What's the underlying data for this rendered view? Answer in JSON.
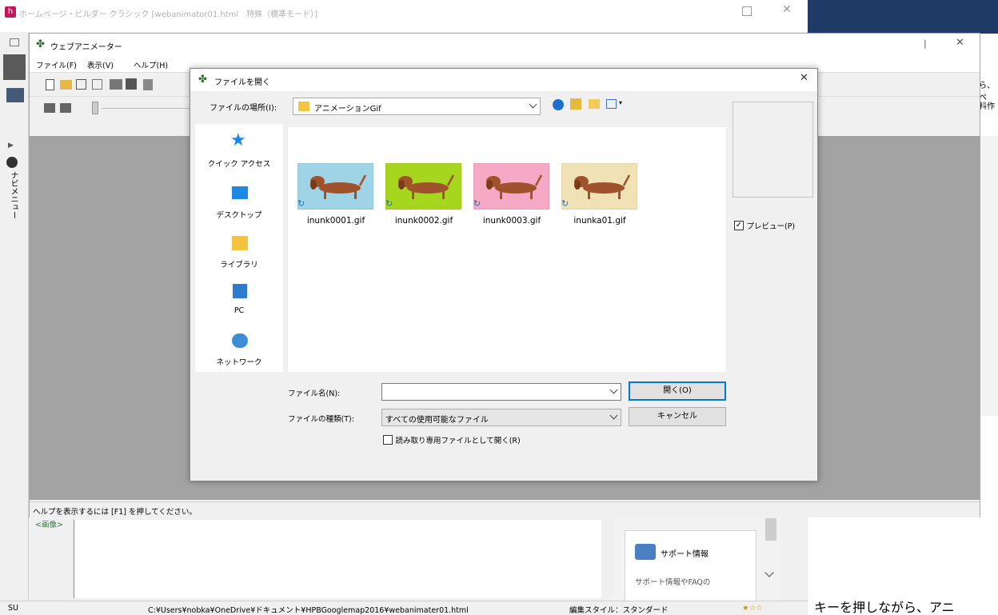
{
  "main_window": {
    "title": "ホームページ・ビルダー クラシック [webanimator01.html　特殊（標準モード）]",
    "status": {
      "left": "SU",
      "path": "C:¥Users¥nobka¥OneDrive¥ドキュメント¥HPBGooglemap2016¥webanimater01.html",
      "style": "編集スタイル：スタンダード",
      "stars": "★☆☆"
    },
    "left_tab": "ナビメニュー",
    "editor_tag": "<画像>",
    "support": {
      "title": "サポート情報",
      "desc": "サポート情報やFAQの"
    },
    "right_fragments": {
      "top1": "ら、ペ",
      "top2": "料作",
      "bottom": "キーを押しながら、アニ"
    }
  },
  "animator": {
    "title": "ウェブアニメーター",
    "menu": [
      "ファイル(F)",
      "表示(V)",
      "ヘルプ(H)"
    ],
    "status": "ヘルプを表示するには [F1] を押してください。"
  },
  "dialog": {
    "title": "ファイルを開く",
    "location_label": "ファイルの場所(I):",
    "location_value": "アニメーションGif",
    "places": [
      {
        "label": "クイック アクセス",
        "icon": "star-icon"
      },
      {
        "label": "デスクトップ",
        "icon": "desktop-icon"
      },
      {
        "label": "ライブラリ",
        "icon": "library-icon"
      },
      {
        "label": "PC",
        "icon": "pc-icon"
      },
      {
        "label": "ネットワーク",
        "icon": "network-icon"
      }
    ],
    "files": [
      {
        "name": "inunk0001.gif",
        "bg": "#9fd3e6"
      },
      {
        "name": "inunk0002.gif",
        "bg": "#a6d61e"
      },
      {
        "name": "inunk0003.gif",
        "bg": "#f6a9c4"
      },
      {
        "name": "inunka01.gif",
        "bg": "#f0e2b4"
      }
    ],
    "filename_label": "ファイル名(N):",
    "filename_value": "",
    "filetype_label": "ファイルの種類(T):",
    "filetype_value": "すべての使用可能なファイル",
    "open_button": "開く(O)",
    "cancel_button": "キャンセル",
    "readonly_label": "読み取り専用ファイルとして開く(R)",
    "preview_label": "プレビュー(P)",
    "preview_checked": true
  },
  "colors": {
    "workspace": "#a3a3a3",
    "right_navy": "#1f3a66",
    "accent": "#0078d7"
  }
}
